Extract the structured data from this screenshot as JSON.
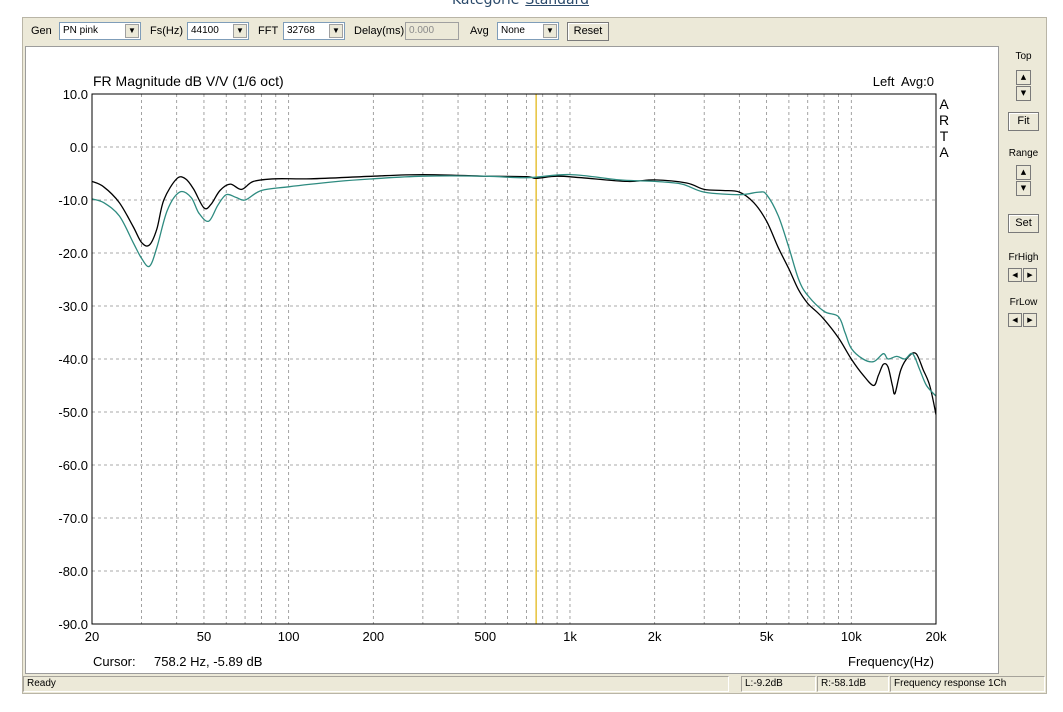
{
  "page": {
    "kategorie_label": "Kategorie",
    "kategorie_link": "Standard"
  },
  "toolbar": {
    "gen_label": "Gen",
    "gen_value": "PN pink",
    "fs_label": "Fs(Hz)",
    "fs_value": "44100",
    "fft_label": "FFT",
    "fft_value": "32768",
    "delay_label": "Delay(ms)",
    "delay_value": "0.000",
    "avg_label": "Avg",
    "avg_value": "None",
    "reset_label": "Reset"
  },
  "sidebar": {
    "top_label": "Top",
    "fit_label": "Fit",
    "range_label": "Range",
    "set_label": "Set",
    "frhigh_label": "FrHigh",
    "frlow_label": "FrLow"
  },
  "status": {
    "ready": "Ready",
    "left": "L:-9.2dB",
    "right": "R:-58.1dB",
    "mode": "Frequency response 1Ch"
  },
  "colors": {
    "series_black": "#000000",
    "series_teal": "#2e8b80",
    "cursor": "#e6c23a",
    "grid": "#8c8c8c"
  },
  "chart_data": {
    "type": "line",
    "title": "FR Magnitude dB V/V (1/6 oct)",
    "channel_info": "Left  Avg:0",
    "brand": [
      "A",
      "R",
      "T",
      "A"
    ],
    "xlabel": "Frequency(Hz)",
    "ylabel": "",
    "xscale": "log",
    "xlim": [
      20,
      20000
    ],
    "ylim": [
      -90,
      10
    ],
    "xticks": [
      {
        "value": 20,
        "label": "20"
      },
      {
        "value": 50,
        "label": "50"
      },
      {
        "value": 100,
        "label": "100"
      },
      {
        "value": 200,
        "label": "200"
      },
      {
        "value": 500,
        "label": "500"
      },
      {
        "value": 1000,
        "label": "1k"
      },
      {
        "value": 2000,
        "label": "2k"
      },
      {
        "value": 5000,
        "label": "5k"
      },
      {
        "value": 10000,
        "label": "10k"
      },
      {
        "value": 20000,
        "label": "20k"
      }
    ],
    "yticks": [
      {
        "value": 10,
        "label": "10.0"
      },
      {
        "value": 0,
        "label": "0.0"
      },
      {
        "value": -10,
        "label": "-10.0"
      },
      {
        "value": -20,
        "label": "-20.0"
      },
      {
        "value": -30,
        "label": "-30.0"
      },
      {
        "value": -40,
        "label": "-40.0"
      },
      {
        "value": -50,
        "label": "-50.0"
      },
      {
        "value": -60,
        "label": "-60.0"
      },
      {
        "value": -70,
        "label": "-70.0"
      },
      {
        "value": -80,
        "label": "-80.0"
      },
      {
        "value": -90,
        "label": "-90.0"
      }
    ],
    "grid": true,
    "cursor": {
      "freq": 758.2,
      "label": "Cursor:",
      "readout": "758.2 Hz, -5.89 dB"
    },
    "series": [
      {
        "color": "#000000",
        "points": [
          [
            20,
            -6.5
          ],
          [
            22,
            -7.5
          ],
          [
            25,
            -10.5
          ],
          [
            28,
            -15
          ],
          [
            30,
            -18
          ],
          [
            32,
            -18.5
          ],
          [
            34,
            -15.5
          ],
          [
            36,
            -10
          ],
          [
            40,
            -6
          ],
          [
            43,
            -6
          ],
          [
            46,
            -8
          ],
          [
            50,
            -11.5
          ],
          [
            53,
            -10.8
          ],
          [
            57,
            -8.2
          ],
          [
            62,
            -7
          ],
          [
            68,
            -8
          ],
          [
            75,
            -6.5
          ],
          [
            90,
            -6
          ],
          [
            120,
            -6
          ],
          [
            200,
            -5.5
          ],
          [
            300,
            -5.2
          ],
          [
            500,
            -5.5
          ],
          [
            700,
            -5.6
          ],
          [
            758,
            -5.9
          ],
          [
            900,
            -5.5
          ],
          [
            1100,
            -5.8
          ],
          [
            1600,
            -6.5
          ],
          [
            2000,
            -6.2
          ],
          [
            2600,
            -6.8
          ],
          [
            3000,
            -8
          ],
          [
            3500,
            -8.2
          ],
          [
            4000,
            -8.5
          ],
          [
            4500,
            -10.5
          ],
          [
            5000,
            -14
          ],
          [
            5500,
            -19
          ],
          [
            6000,
            -23
          ],
          [
            6500,
            -27
          ],
          [
            7000,
            -29.5
          ],
          [
            7500,
            -31
          ],
          [
            8000,
            -32.5
          ],
          [
            9000,
            -36
          ],
          [
            10000,
            -40
          ],
          [
            11000,
            -43
          ],
          [
            12000,
            -45
          ],
          [
            12500,
            -43
          ],
          [
            13000,
            -41
          ],
          [
            13500,
            -41.5
          ],
          [
            14000,
            -45
          ],
          [
            14300,
            -46.5
          ],
          [
            15000,
            -42
          ],
          [
            16000,
            -39.5
          ],
          [
            17000,
            -39
          ],
          [
            18000,
            -42
          ],
          [
            19000,
            -45
          ],
          [
            20000,
            -50.5
          ]
        ]
      },
      {
        "color": "#2e8b80",
        "points": [
          [
            20,
            -9.8
          ],
          [
            22,
            -10.5
          ],
          [
            25,
            -13
          ],
          [
            28,
            -18
          ],
          [
            30,
            -21
          ],
          [
            32,
            -22.5
          ],
          [
            34,
            -19
          ],
          [
            37,
            -12
          ],
          [
            41,
            -8.5
          ],
          [
            45,
            -9.5
          ],
          [
            48,
            -12.5
          ],
          [
            52,
            -14
          ],
          [
            56,
            -11
          ],
          [
            60,
            -9
          ],
          [
            65,
            -9.5
          ],
          [
            70,
            -10
          ],
          [
            80,
            -8.2
          ],
          [
            100,
            -7.5
          ],
          [
            150,
            -6.5
          ],
          [
            200,
            -6
          ],
          [
            300,
            -5.5
          ],
          [
            500,
            -5.5
          ],
          [
            700,
            -5.8
          ],
          [
            1000,
            -5.2
          ],
          [
            1500,
            -6.2
          ],
          [
            2000,
            -6.5
          ],
          [
            2500,
            -7
          ],
          [
            3000,
            -8.5
          ],
          [
            4000,
            -9
          ],
          [
            4700,
            -8.5
          ],
          [
            5000,
            -9
          ],
          [
            5500,
            -13
          ],
          [
            6000,
            -19
          ],
          [
            6500,
            -25
          ],
          [
            7000,
            -28
          ],
          [
            8000,
            -31
          ],
          [
            9000,
            -32
          ],
          [
            9500,
            -35
          ],
          [
            10000,
            -38
          ],
          [
            11000,
            -40
          ],
          [
            12000,
            -40.5
          ],
          [
            13000,
            -39
          ],
          [
            13500,
            -40
          ],
          [
            14500,
            -39.5
          ],
          [
            15500,
            -40
          ],
          [
            16500,
            -39
          ],
          [
            17500,
            -42
          ],
          [
            18500,
            -45
          ],
          [
            20000,
            -47
          ]
        ]
      }
    ]
  }
}
